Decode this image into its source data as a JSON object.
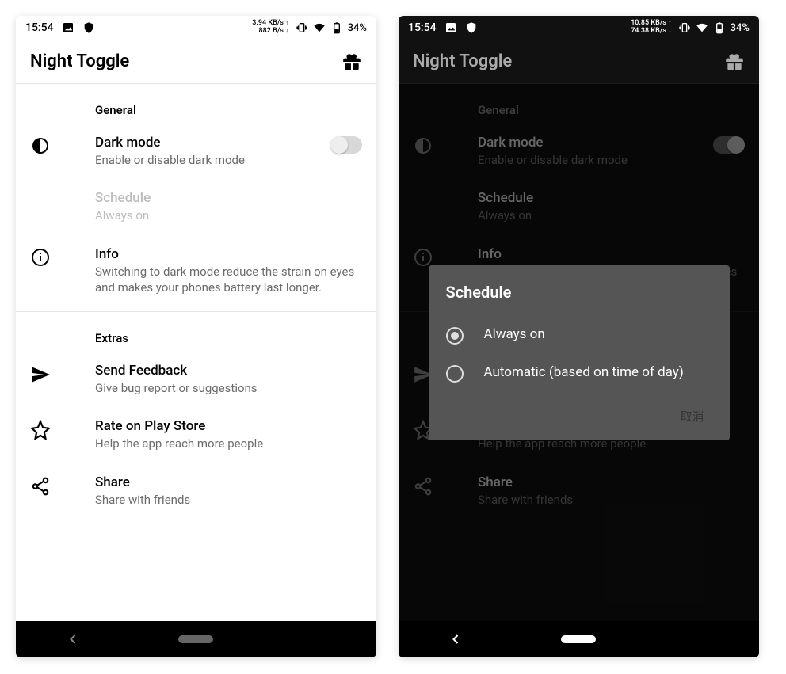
{
  "status": {
    "time": "15:54",
    "battery": "34%",
    "net_light": {
      "up": "3.94 KB/s ↑",
      "down": "882 B/s ↓"
    },
    "net_dark": {
      "up": "10.85 KB/s ↑",
      "down": "74.38 KB/s ↓"
    }
  },
  "appbar": {
    "title": "Night Toggle"
  },
  "general": {
    "header": "General",
    "dark_mode": {
      "title": "Dark mode",
      "sub": "Enable or disable dark mode"
    },
    "schedule": {
      "title": "Schedule",
      "sub": "Always on"
    },
    "info": {
      "title": "Info",
      "sub": "Switching to dark mode reduce the strain on eyes and makes your phones battery last longer."
    }
  },
  "extras": {
    "header": "Extras",
    "feedback": {
      "title": "Send Feedback",
      "sub": "Give bug report or suggestions"
    },
    "rate": {
      "title": "Rate on Play Store",
      "sub": "Help the app reach more people"
    },
    "share": {
      "title": "Share",
      "sub": "Share with friends"
    }
  },
  "dialog": {
    "title": "Schedule",
    "opt1": "Always on",
    "opt2": "Automatic (based on time of day)",
    "cancel": "取消"
  }
}
